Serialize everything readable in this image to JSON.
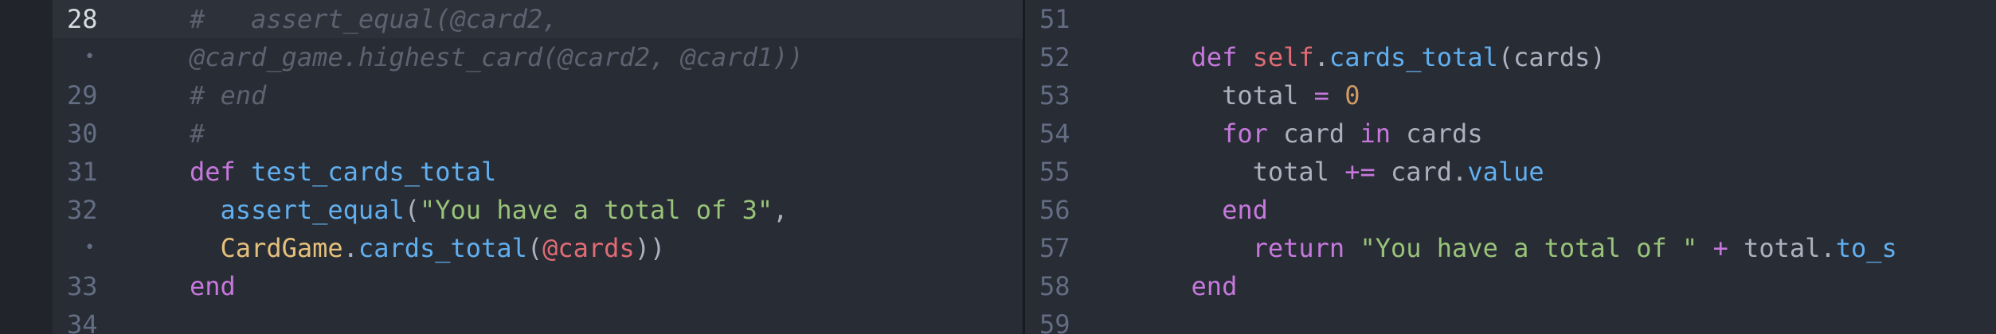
{
  "left_pane": {
    "lines": [
      {
        "number": "28",
        "active": true,
        "tokens": [
          {
            "t": "#   assert_equal(@card2,",
            "c": "tok-comment"
          }
        ]
      },
      {
        "number": "•",
        "wrap": true,
        "tokens": [
          {
            "t": "@card_game.highest_card(@card2, @card1))",
            "c": "tok-comment"
          }
        ]
      },
      {
        "number": "29",
        "tokens": [
          {
            "t": "# end",
            "c": "tok-comment"
          }
        ]
      },
      {
        "number": "30",
        "tokens": [
          {
            "t": "#",
            "c": "tok-comment"
          }
        ]
      },
      {
        "number": "31",
        "tokens": [
          {
            "t": "def",
            "c": "tok-keyword"
          },
          {
            "t": " ",
            "c": "tok-plain"
          },
          {
            "t": "test_cards_total",
            "c": "tok-func"
          }
        ]
      },
      {
        "number": "32",
        "tokens": [
          {
            "t": "  ",
            "c": "tok-plain"
          },
          {
            "t": "assert_equal",
            "c": "tok-func"
          },
          {
            "t": "(",
            "c": "tok-plain"
          },
          {
            "t": "\"You have a total of 3\"",
            "c": "tok-string"
          },
          {
            "t": ",",
            "c": "tok-plain"
          }
        ]
      },
      {
        "number": "•",
        "wrap": true,
        "tokens": [
          {
            "t": "  ",
            "c": "tok-plain"
          },
          {
            "t": "CardGame",
            "c": "tok-class"
          },
          {
            "t": ".",
            "c": "tok-plain"
          },
          {
            "t": "cards_total",
            "c": "tok-func"
          },
          {
            "t": "(",
            "c": "tok-plain"
          },
          {
            "t": "@cards",
            "c": "tok-ivar"
          },
          {
            "t": "))",
            "c": "tok-plain"
          }
        ]
      },
      {
        "number": "33",
        "tokens": [
          {
            "t": "end",
            "c": "tok-keyword"
          }
        ]
      },
      {
        "number": "34",
        "tokens": []
      }
    ]
  },
  "right_pane": {
    "lines": [
      {
        "number": "51",
        "tokens": []
      },
      {
        "number": "52",
        "tokens": [
          {
            "t": "  ",
            "c": "tok-plain"
          },
          {
            "t": "def",
            "c": "tok-keyword"
          },
          {
            "t": " ",
            "c": "tok-plain"
          },
          {
            "t": "self",
            "c": "tok-self"
          },
          {
            "t": ".",
            "c": "tok-plain"
          },
          {
            "t": "cards_total",
            "c": "tok-func"
          },
          {
            "t": "(cards)",
            "c": "tok-plain"
          }
        ]
      },
      {
        "number": "53",
        "tokens": [
          {
            "t": "    total ",
            "c": "tok-plain"
          },
          {
            "t": "=",
            "c": "tok-op"
          },
          {
            "t": " ",
            "c": "tok-plain"
          },
          {
            "t": "0",
            "c": "tok-number"
          }
        ]
      },
      {
        "number": "54",
        "tokens": [
          {
            "t": "    ",
            "c": "tok-plain"
          },
          {
            "t": "for",
            "c": "tok-keyword"
          },
          {
            "t": " card ",
            "c": "tok-plain"
          },
          {
            "t": "in",
            "c": "tok-keyword"
          },
          {
            "t": " cards",
            "c": "tok-plain"
          }
        ]
      },
      {
        "number": "55",
        "tokens": [
          {
            "t": "      total ",
            "c": "tok-plain"
          },
          {
            "t": "+=",
            "c": "tok-op"
          },
          {
            "t": " card.",
            "c": "tok-plain"
          },
          {
            "t": "value",
            "c": "tok-func"
          }
        ]
      },
      {
        "number": "56",
        "tokens": [
          {
            "t": "    ",
            "c": "tok-plain"
          },
          {
            "t": "end",
            "c": "tok-keyword"
          }
        ]
      },
      {
        "number": "57",
        "tokens": [
          {
            "t": "      ",
            "c": "tok-plain"
          },
          {
            "t": "return",
            "c": "tok-keyword"
          },
          {
            "t": " ",
            "c": "tok-plain"
          },
          {
            "t": "\"You have a total of \"",
            "c": "tok-string"
          },
          {
            "t": " ",
            "c": "tok-plain"
          },
          {
            "t": "+",
            "c": "tok-op"
          },
          {
            "t": " total.",
            "c": "tok-plain"
          },
          {
            "t": "to_s",
            "c": "tok-func"
          }
        ]
      },
      {
        "number": "58",
        "tokens": [
          {
            "t": "  ",
            "c": "tok-plain"
          },
          {
            "t": "end",
            "c": "tok-keyword"
          }
        ]
      },
      {
        "number": "59",
        "tokens": []
      }
    ]
  },
  "colors": {
    "background": "#282c34",
    "gutter_edge": "#21252b",
    "active_line": "#2c313a",
    "comment": "#5c6370",
    "keyword": "#c678dd",
    "function": "#61afef",
    "string": "#98c379",
    "class": "#e5c07b",
    "ivar": "#e06c75",
    "number": "#d19a66"
  }
}
